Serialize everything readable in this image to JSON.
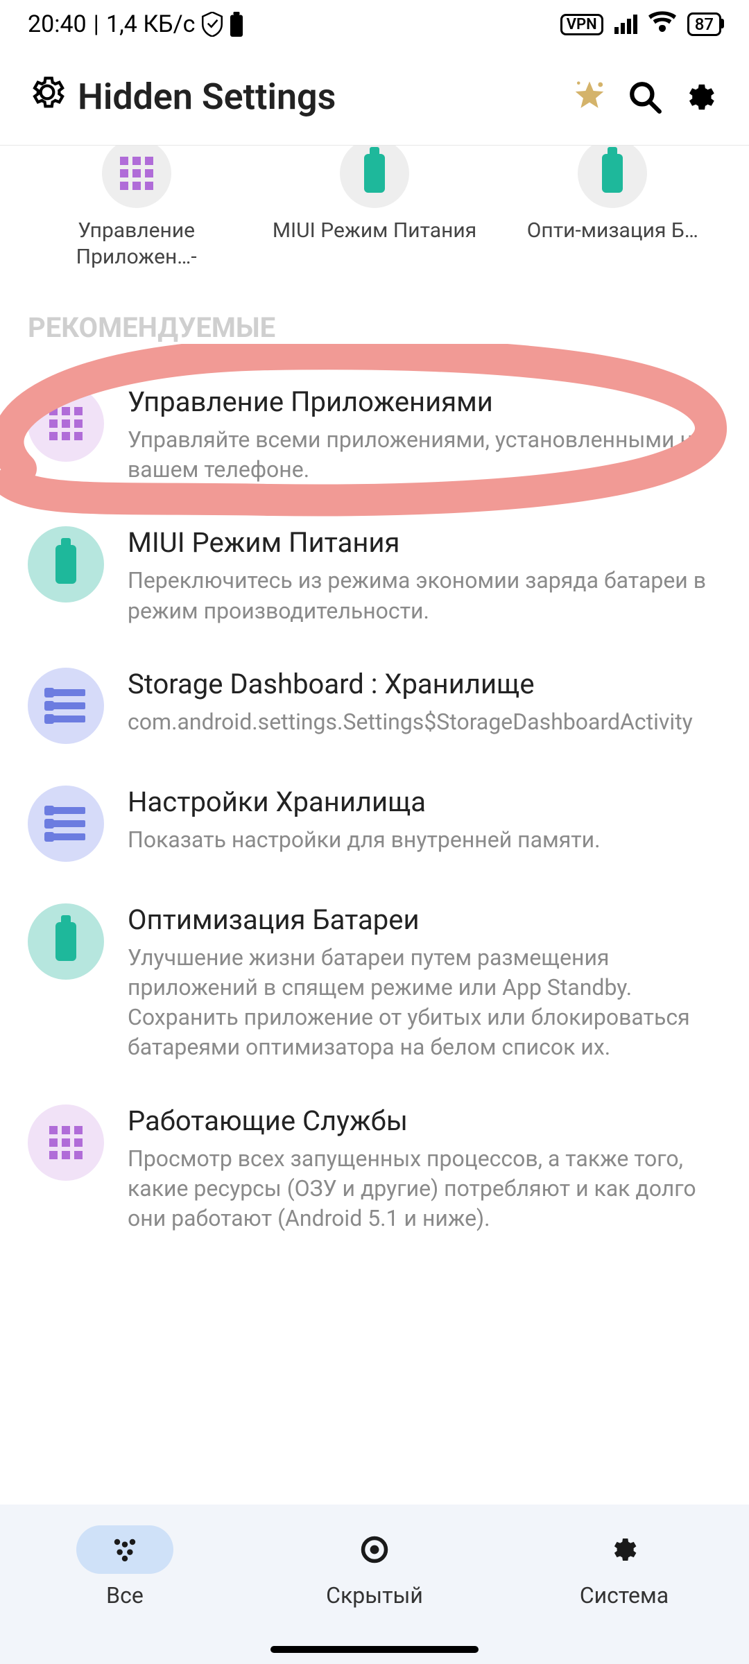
{
  "status": {
    "time": "20:40",
    "speed": "1,4 КБ/с",
    "vpn": "VPN",
    "battery": "87"
  },
  "header": {
    "title": "Hidden Settings"
  },
  "shortcuts": [
    {
      "label": "Управление Приложен…-"
    },
    {
      "label": "MIUI Режим Питания"
    },
    {
      "label": "Опти-мизация Б…"
    }
  ],
  "section_title": "РЕКОМЕНДУЕМЫЕ",
  "items": [
    {
      "title": "Управление Приложениями",
      "desc": "Управляйте всеми приложениями, установленными на вашем телефоне."
    },
    {
      "title": "MIUI Режим Питания",
      "desc": "Переключитесь из режима экономии заряда батареи в режим производительности."
    },
    {
      "title": "Storage Dashboard : Хранилище",
      "desc": "com.android.settings.Settings$StorageDashboardActivity"
    },
    {
      "title": "Настройки Хранилища",
      "desc": "Показать настройки для внутренней памяти."
    },
    {
      "title": "Оптимизация Батареи",
      "desc": "Улучшение жизни батареи путем размещения приложений в спящем режиме или App Standby. Сохранить приложение от убитых или блокироваться батареями оптимизатора на белом список их."
    },
    {
      "title": "Работающие Службы",
      "desc": "Просмотр всех запущенных процессов, а также того, какие ресурсы (ОЗУ и другие) потребляют и как долго они работают (Android 5.1 и ниже)."
    }
  ],
  "nav": {
    "all": "Все",
    "hidden": "Скрытый",
    "system": "Система"
  }
}
